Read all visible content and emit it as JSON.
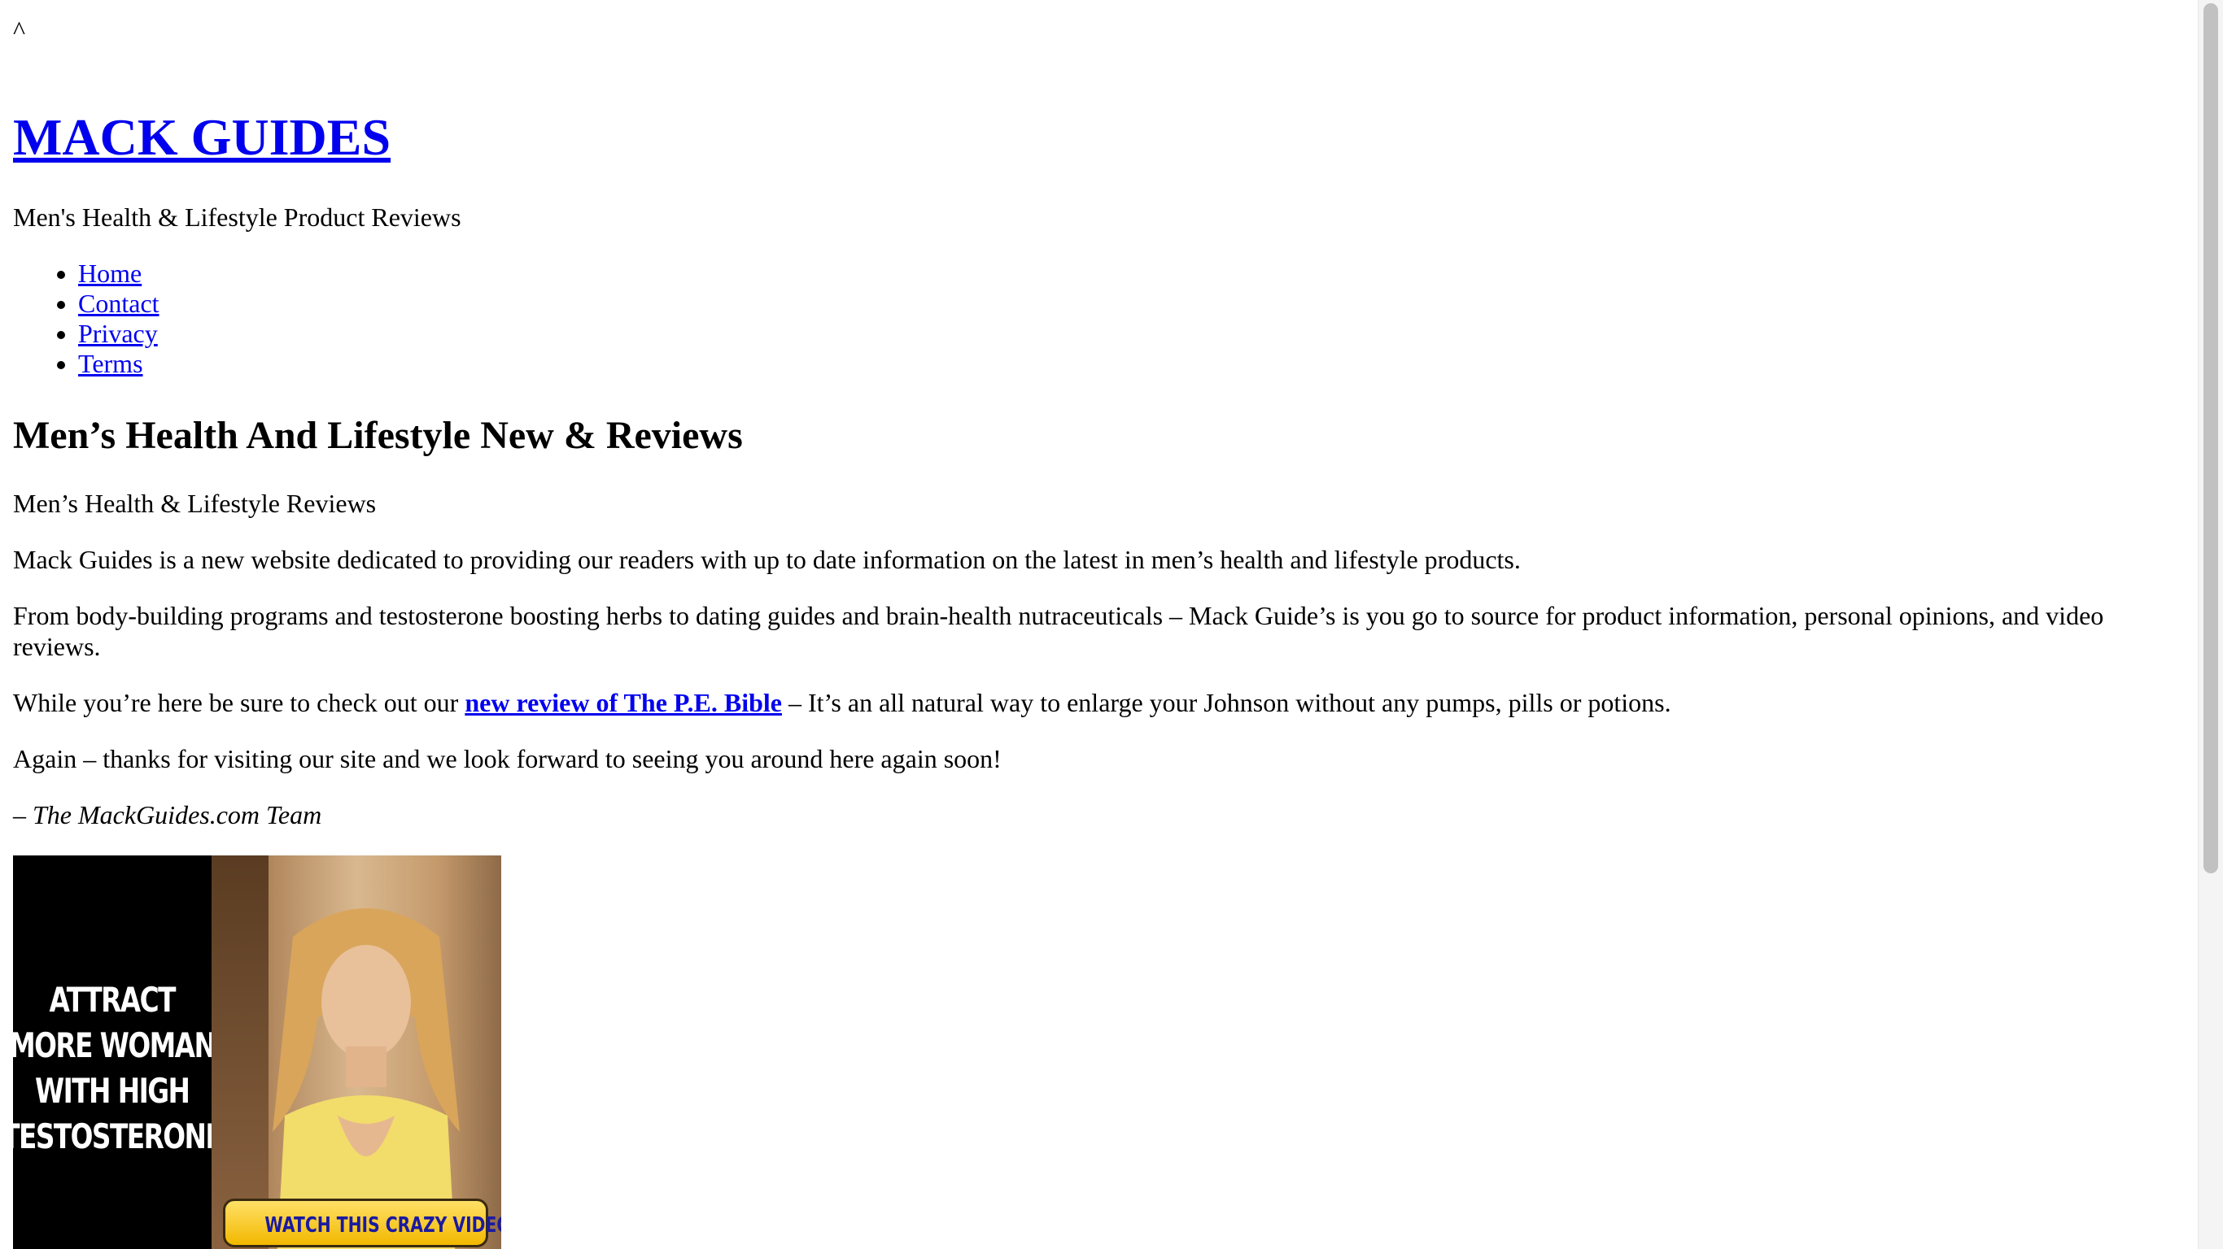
{
  "caret": "^",
  "site": {
    "title": "MACK GUIDES",
    "tagline": "Men's Health & Lifestyle Product Reviews"
  },
  "nav": {
    "items": [
      {
        "label": "Home"
      },
      {
        "label": "Contact"
      },
      {
        "label": "Privacy"
      },
      {
        "label": "Terms"
      }
    ]
  },
  "post": {
    "title": "Men’s Health And Lifestyle New & Reviews",
    "subtitle": "Men’s Health & Lifestyle Reviews",
    "p1": "Mack Guides is a new website dedicated to providing our readers with up to date information on the latest in men’s health and lifestyle products.",
    "p2": "From body-building programs and testosterone boosting herbs to dating guides and brain-health nutraceuticals – Mack Guide’s is you go to source for product information, personal opinions, and video reviews.",
    "p3_before": "While you’re here be sure to check out our ",
    "p3_link": "new review of The P.E. Bible",
    "p3_after": " – It’s an all natural way to enlarge your Johnson without any pumps, pills or potions.",
    "p4": "Again – thanks for visiting our site and we look forward to seeing you around here again soon!",
    "signature": " – The MackGuides.com Team"
  },
  "ad": {
    "headline": "ATTRACT\nMORE WOMAN\nWITH HIGH\nTESTOSTERONE",
    "cta": "WATCH THIS CRAZY VIDEO >>"
  },
  "colors": {
    "link": "#0000ee",
    "text": "#000000",
    "background": "#ffffff"
  }
}
